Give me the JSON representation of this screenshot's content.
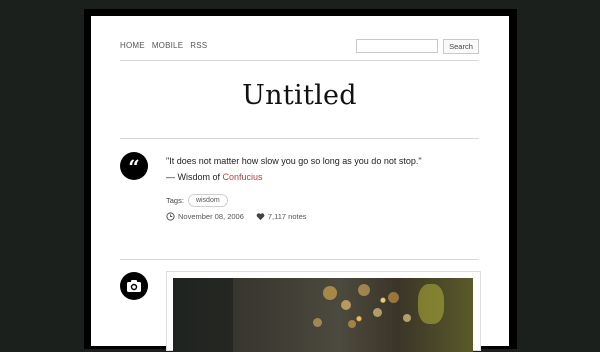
{
  "nav": {
    "items": [
      "HOME",
      "MOBILE",
      "RSS"
    ]
  },
  "search": {
    "placeholder": "",
    "button_label": "Search"
  },
  "site": {
    "title": "Untitled"
  },
  "posts": [
    {
      "type_icon": "quote-icon",
      "quote": "\"It does not matter how slow you go so long as you do not stop.\"",
      "source_prefix": "— Wisdom of ",
      "source_link": "Confucius",
      "tags_label": "Tags:",
      "tags": [
        "wisdom"
      ],
      "date": "November 08, 2006",
      "notes": "7,117 notes"
    },
    {
      "type_icon": "camera-icon"
    }
  ],
  "colors": {
    "background": "#1c201d",
    "link": "#b0413e",
    "text": "#222222"
  }
}
